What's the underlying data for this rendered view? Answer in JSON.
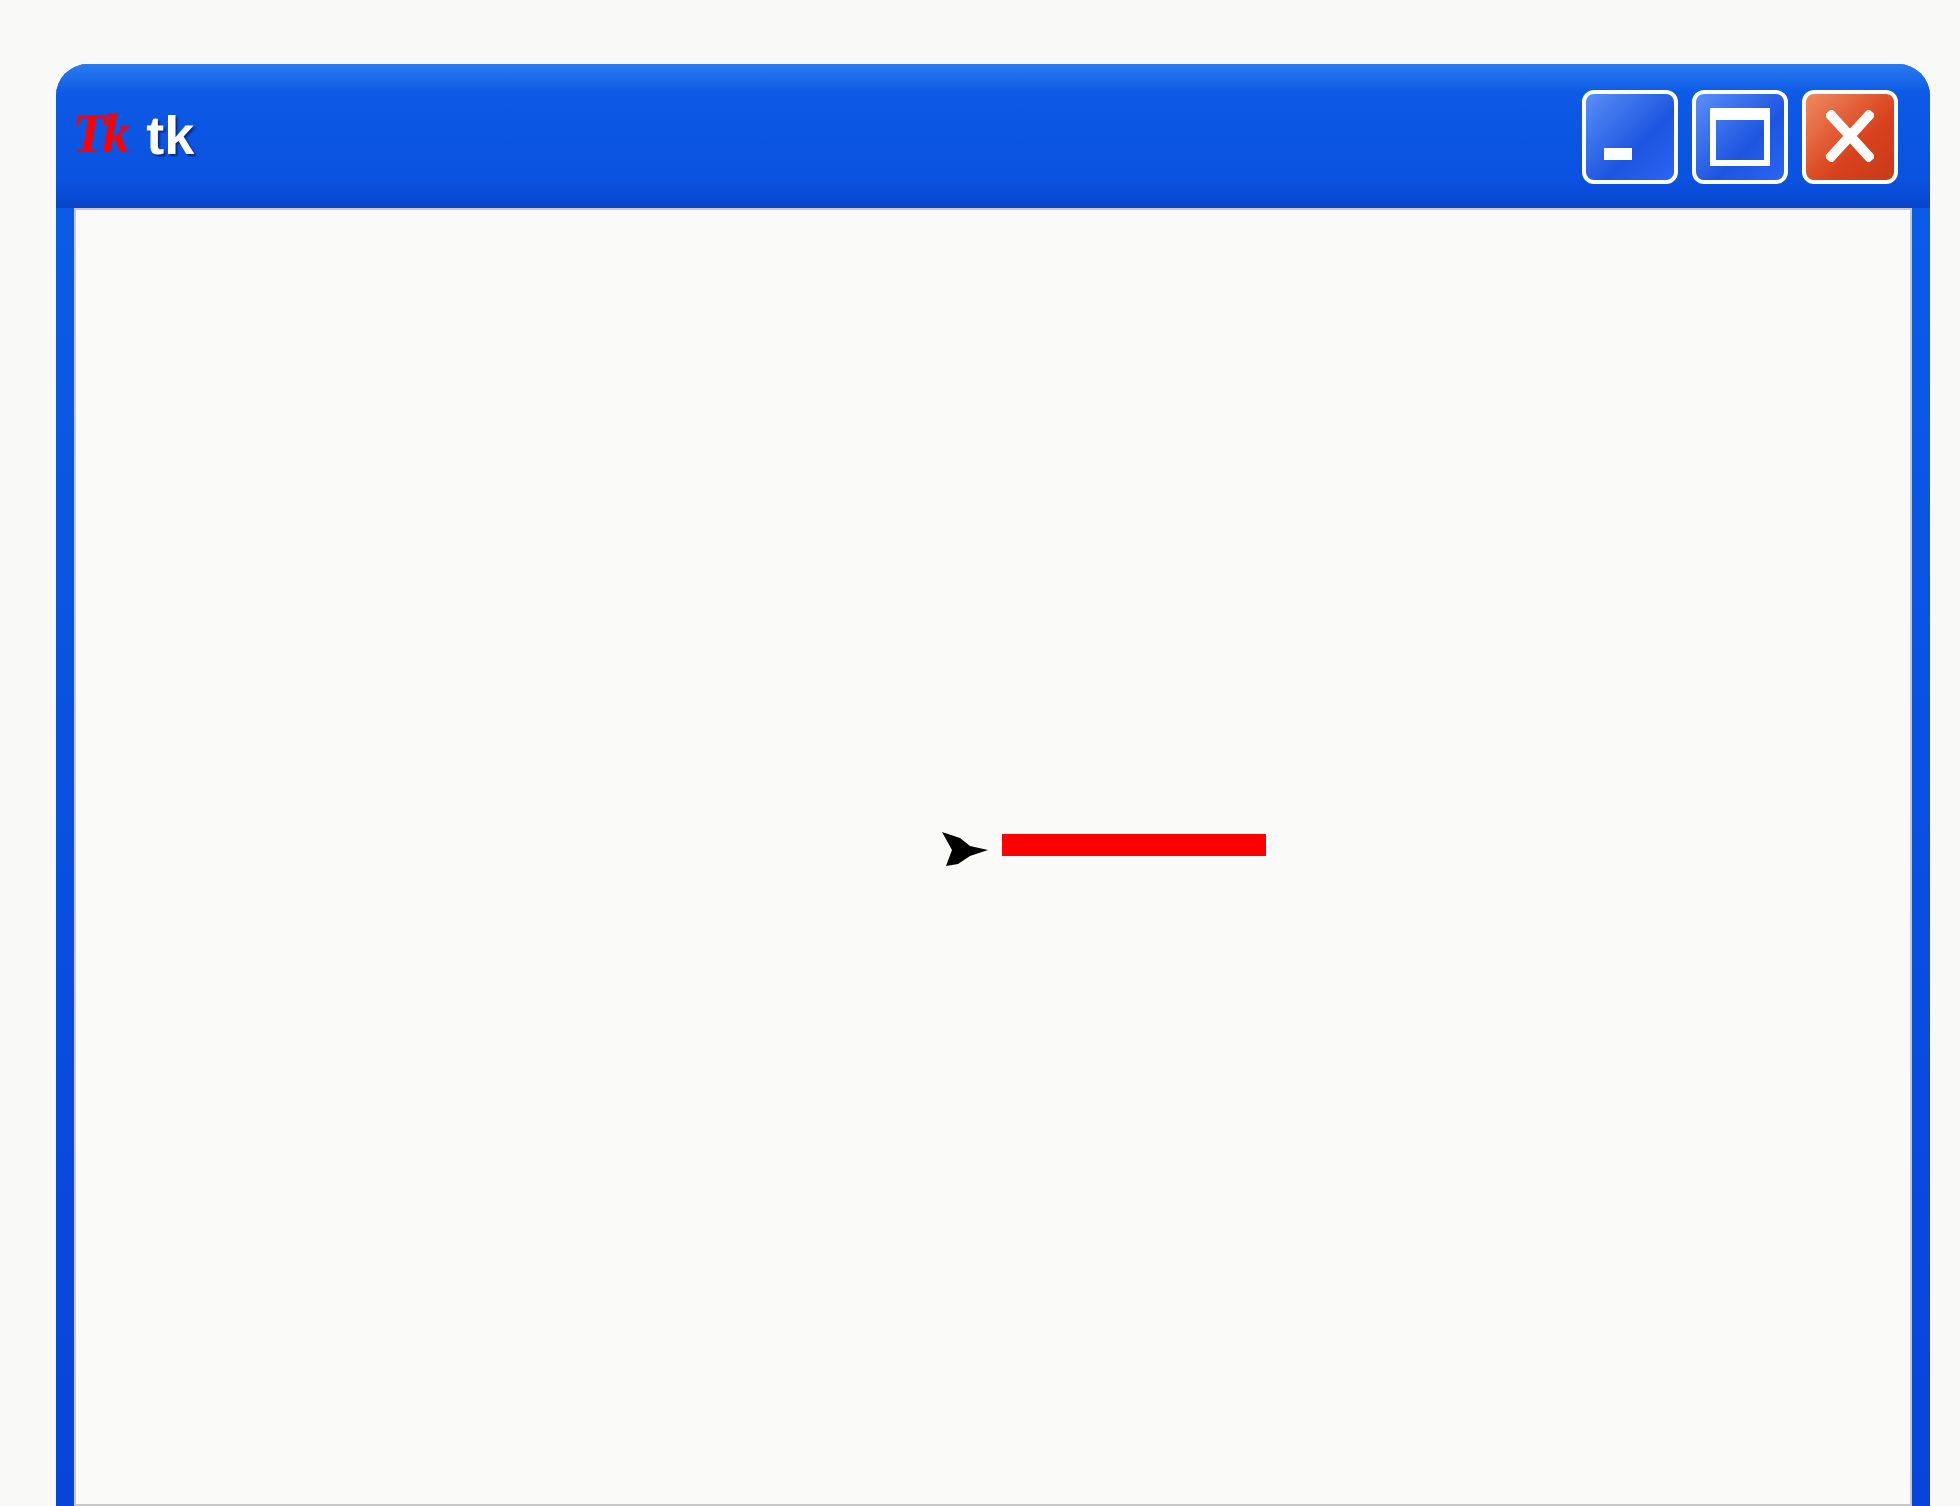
{
  "window": {
    "title": "tk",
    "logo": "Tk",
    "buttons": [
      {
        "kind": "minimize"
      },
      {
        "kind": "maximize"
      },
      {
        "kind": "close"
      }
    ]
  }
}
